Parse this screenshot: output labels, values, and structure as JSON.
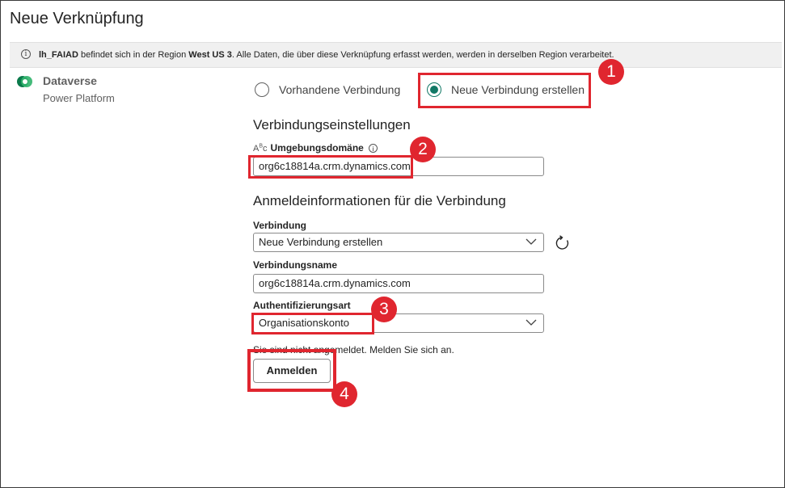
{
  "dialog": {
    "title": "Neue Verknüpfung"
  },
  "infobar": {
    "lakehouse": "lh_FAIAD",
    "text_before_region": " befindet sich in der Region ",
    "region": "West US 3",
    "text_after_region": ". Alle Daten, die über diese Verknüpfung erfasst werden, werden in derselben Region verarbeitet."
  },
  "connector": {
    "name": "Dataverse",
    "subtitle": "Power Platform"
  },
  "radio_options": {
    "existing": "Vorhandene Verbindung",
    "new": "Neue Verbindung erstellen",
    "selected": "new"
  },
  "connection_settings": {
    "heading": "Verbindungseinstellungen",
    "environment_domain_label": "Umgebungsdomäne",
    "environment_domain_value": "org6c18814a.crm.dynamics.com"
  },
  "credentials": {
    "heading": "Anmeldeinformationen für die Verbindung",
    "connection_label": "Verbindung",
    "connection_value": "Neue Verbindung erstellen",
    "connection_name_label": "Verbindungsname",
    "connection_name_value": "org6c18814a.crm.dynamics.com",
    "auth_label": "Authentifizierungsart",
    "auth_value": "Organisationskonto",
    "signin_note": "Sie sind nicht angemeldet. Melden Sie sich an.",
    "signin_button": "Anmelden"
  },
  "annotations": [
    "1",
    "2",
    "3",
    "4"
  ],
  "colors": {
    "accent": "#117865",
    "highlight": "#e0262f"
  }
}
